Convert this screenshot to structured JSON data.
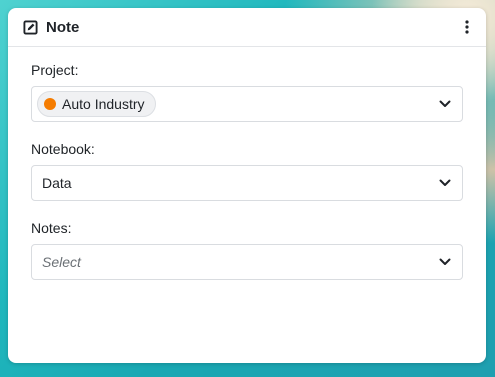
{
  "card": {
    "title": "Note",
    "header_icon": "edit-square-icon",
    "menu_icon": "kebab-menu-icon"
  },
  "fields": {
    "project": {
      "label": "Project:",
      "value": "Auto Industry",
      "chip_color": "#f57c00"
    },
    "notebook": {
      "label": "Notebook:",
      "value": "Data"
    },
    "notes": {
      "label": "Notes:",
      "placeholder": "Select"
    }
  },
  "icons": {
    "dropdown": "chevron-down-icon"
  }
}
